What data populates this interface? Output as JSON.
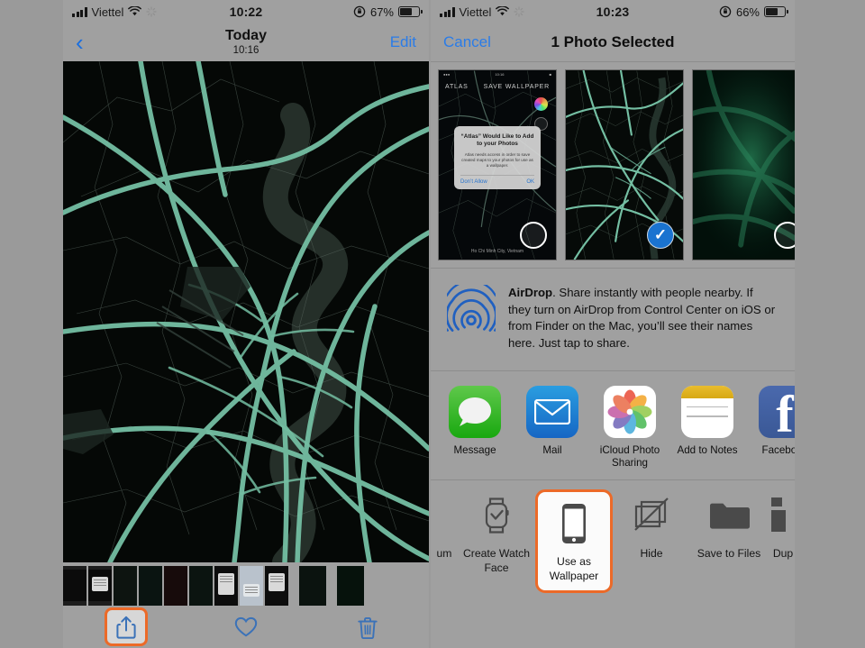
{
  "left_panel": {
    "status_bar": {
      "carrier": "Viettel",
      "time": "10:22",
      "battery_percent": "67%",
      "signal_icon": "signal-bars-icon",
      "wifi_icon": "wifi-icon",
      "activity_icon": "activity-spinner-icon",
      "rotation_lock_icon": "rotation-lock-icon",
      "battery_icon": "battery-icon",
      "battery_level": 67
    },
    "nav": {
      "back_icon": "chevron-left-icon",
      "title": "Today",
      "subtitle": "10:16",
      "edit_label": "Edit"
    },
    "photo": {
      "description": "dark city street map wallpaper",
      "background_color": "#050806",
      "road_color": "#74bfa3",
      "water_color": "#243831",
      "minor_road_color": "#3e4a45"
    },
    "toolbar": {
      "share_icon": "share-icon",
      "favorite_icon": "heart-icon",
      "delete_icon": "trash-icon",
      "highlight_color": "#ec6a28",
      "icon_color": "#3b72b8"
    },
    "filmstrip_count": 11
  },
  "right_panel": {
    "status_bar": {
      "carrier": "Viettel",
      "time": "10:23",
      "battery_percent": "66%",
      "battery_level": 66
    },
    "nav": {
      "cancel_label": "Cancel",
      "title": "1 Photo Selected"
    },
    "thumbnails": [
      {
        "name": "atlas-permission-screenshot",
        "selected": false,
        "app_title": "ATLAS",
        "app_action": "SAVE WALLPAPER",
        "alert_title": "“Atlas” Would Like to Add to your Photos",
        "alert_body": "Atlas needs access in order to save created maps to your photos for use as a wallpaper.",
        "alert_deny": "Don’t Allow",
        "alert_ok": "OK",
        "footer": "Ho Chi Minh City, Vietnam"
      },
      {
        "name": "city-map-photo",
        "selected": true
      },
      {
        "name": "green-glow-map-photo",
        "selected": false
      },
      {
        "name": "partial-thumbnail",
        "selected": false
      }
    ],
    "airdrop": {
      "icon": "airdrop-icon",
      "bold_prefix": "AirDrop",
      "text": ". Share instantly with people nearby. If they turn on AirDrop from Control Center on iOS or from Finder on the Mac, you’ll see their names here. Just tap to share."
    },
    "apps": [
      {
        "label": "Message",
        "icon": "message-icon"
      },
      {
        "label": "Mail",
        "icon": "mail-icon"
      },
      {
        "label": "iCloud Photo Sharing",
        "icon": "photos-icon"
      },
      {
        "label": "Add to Notes",
        "icon": "notes-icon"
      },
      {
        "label": "Facebook",
        "icon": "facebook-icon"
      }
    ],
    "actions": [
      {
        "label": "um",
        "icon": "album-icon",
        "highlighted": false,
        "partial": true
      },
      {
        "label": "Create Watch Face",
        "icon": "watch-icon",
        "highlighted": false
      },
      {
        "label": "Use as Wallpaper",
        "icon": "iphone-icon",
        "highlighted": true
      },
      {
        "label": "Hide",
        "icon": "hide-icon",
        "highlighted": false
      },
      {
        "label": "Save to Files",
        "icon": "folder-icon",
        "highlighted": false
      },
      {
        "label": "Dup",
        "icon": "duplicate-icon",
        "highlighted": false,
        "partial": true
      }
    ],
    "highlight_color": "#ec6a28"
  }
}
